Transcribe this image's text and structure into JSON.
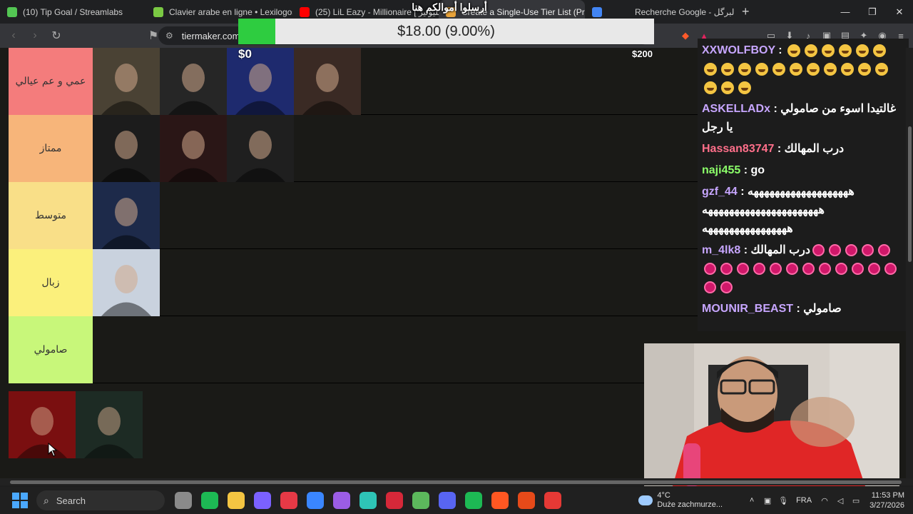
{
  "browser": {
    "tabs": [
      {
        "label": "(10) Tip Goal / Streamlabs",
        "color": "#53c653",
        "active": false
      },
      {
        "label": "Clavier arabe en ligne • Lexilogos",
        "color": "#7ac943",
        "active": false
      },
      {
        "label": "(25) LiL Eazy - Millionaire [ مليونير ]",
        "color": "#ff0000",
        "active": false
      },
      {
        "label": "Create a Single-Use Tier List (Pri",
        "color": "#e8a33a",
        "active": true
      },
      {
        "label": "",
        "color": "#4285f4",
        "active": false
      },
      {
        "label": "Recherche Google - لبرگل",
        "color": "#4285f4",
        "active": false
      }
    ],
    "url": "tiermaker.com/"
  },
  "goal": {
    "title": "أرسلوا أموالكم هنا",
    "amount_text": "$18.00 (9.00%)",
    "progress_percent": 9,
    "min_label": "$0",
    "max_label": "$200",
    "fill_color": "#2ecc40"
  },
  "tiers": [
    {
      "label": "عمي و عم عيالي",
      "color": "#f47c7c",
      "thumbs": [
        "#4a4234",
        "#262626",
        "#1e2a6e",
        "#3a2a24"
      ]
    },
    {
      "label": "ممتاز",
      "color": "#f7b57a",
      "thumbs": [
        "#1c1c1c",
        "#2a1616",
        "#1f1f1f"
      ]
    },
    {
      "label": "متوسط",
      "color": "#f9df88",
      "thumbs": [
        "#1d2a4a"
      ]
    },
    {
      "label": "زبال",
      "color": "#fbf07c",
      "thumbs": [
        "#c9d2de"
      ]
    },
    {
      "label": "صامولي",
      "color": "#c8f77a",
      "thumbs": []
    }
  ],
  "pool": [
    "#7a0f10",
    "#1d2b24"
  ],
  "chat": [
    {
      "user": "XXWOLFBOY",
      "user_style": "purple",
      "text": "",
      "emoji": "laugh",
      "emoji_count": 20
    },
    {
      "user": "ASKELLADx",
      "user_style": "purple",
      "text": "غالتيدا اسوء من صامولي يا رجل",
      "emoji": "",
      "emoji_count": 0
    },
    {
      "user": "Hassan83747",
      "user_style": "red",
      "text": "درب المهالك",
      "emoji": "",
      "emoji_count": 0
    },
    {
      "user": "naji455",
      "user_style": "green",
      "text": "go",
      "emoji": "",
      "emoji_count": 0
    },
    {
      "user": "gzf_44",
      "user_style": "purple",
      "text": "هههههههههههههههههههه ههههههههههههههههههههههه ههههههههههههههههه",
      "emoji": "",
      "emoji_count": 0
    },
    {
      "user": "m_4lk8",
      "user_style": "purple",
      "text": "درب المهالك",
      "emoji": "dot",
      "emoji_count": 19
    },
    {
      "user": "MOUNIR_BEAST",
      "user_style": "purple",
      "text": "صامولي",
      "emoji": "",
      "emoji_count": 0
    }
  ],
  "taskbar": {
    "search_label": "Search",
    "apps": [
      "#8a8a8a",
      "#1db954",
      "#f4c542",
      "#7b61ff",
      "#e63946",
      "#3a86ff",
      "#9b5de5",
      "#2ec4b6",
      "#d62839",
      "#5cb85c",
      "#5865f2",
      "#1db954",
      "#ff5722",
      "#e64a19",
      "#e53935"
    ],
    "weather_temp": "4°C",
    "weather_desc": "Duże zachmurze...",
    "lang": "FRA",
    "time": "11:53 PM",
    "date": "3/27/2026"
  }
}
